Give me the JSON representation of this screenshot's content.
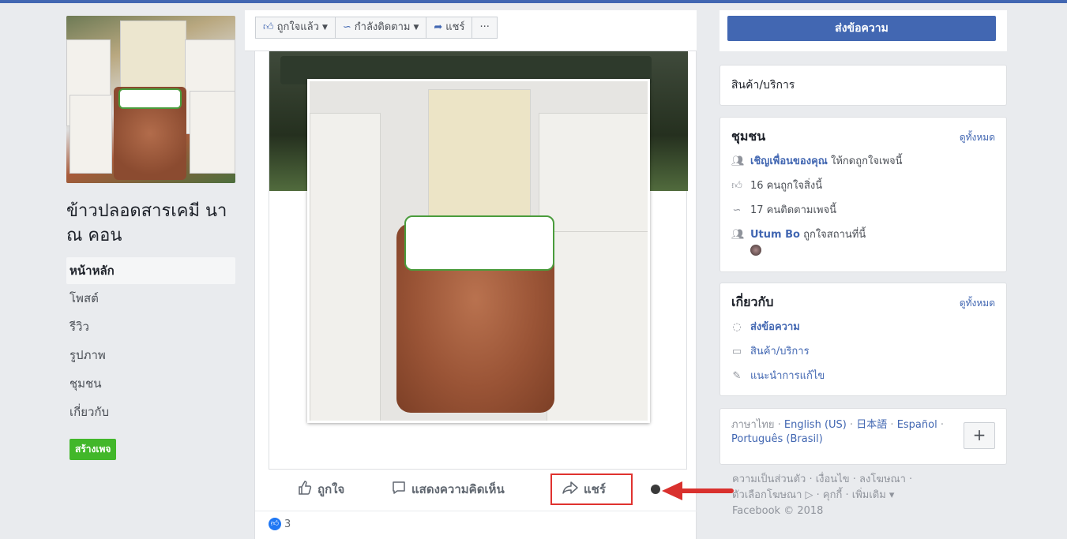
{
  "accent": "#4267b2",
  "page": {
    "name": "ข้าวปลอดสารเคมี นา ณ คอน",
    "nav": [
      "หน้าหลัก",
      "โพสต์",
      "รีวิว",
      "รูปภาพ",
      "ชุมชน",
      "เกี่ยวกับ"
    ],
    "create_page": "สร้างเพจ"
  },
  "toolbar": {
    "liked": "ถูกใจแล้ว",
    "following": "กำลังติดตาม",
    "share": "แชร์",
    "more": "···"
  },
  "post": {
    "actions": {
      "like": "ถูกใจ",
      "comment": "แสดงความคิดเห็น",
      "share": "แชร์"
    },
    "reaction_count": "3"
  },
  "sidebar": {
    "send_message": "ส่งข้อความ",
    "category": "สินค้า/บริการ",
    "community": {
      "title": "ชุมชน",
      "see_all": "ดูทั้งหมด",
      "invite_link": "เชิญเพื่อนของคุณ",
      "invite_rest": "ให้กดถูกใจเพจนี้",
      "likes": "16 คนถูกใจสิ่งนี้",
      "follows": "17 คนติดตามเพจนี้",
      "user_name": "Utum Bo",
      "user_rest": "ถูกใจสถานที่นี้"
    },
    "about": {
      "title": "เกี่ยวกับ",
      "see_all": "ดูทั้งหมด",
      "message": "ส่งข้อความ",
      "category": "สินค้า/บริการ",
      "suggest": "แนะนำการแก้ไข"
    },
    "languages": {
      "current": "ภาษาไทย",
      "others": [
        "English (US)",
        "日本語",
        "Español",
        "Português (Brasil)"
      ],
      "plus": "+"
    },
    "footer": {
      "line1": "ความเป็นส่วนตัว · เงื่อนไข · ลงโฆษณา ·",
      "line2": "ตัวเลือกโฆษณา ▷ · คุกกี้ · เพิ่มเติม ▾",
      "line3": "Facebook © 2018"
    }
  }
}
